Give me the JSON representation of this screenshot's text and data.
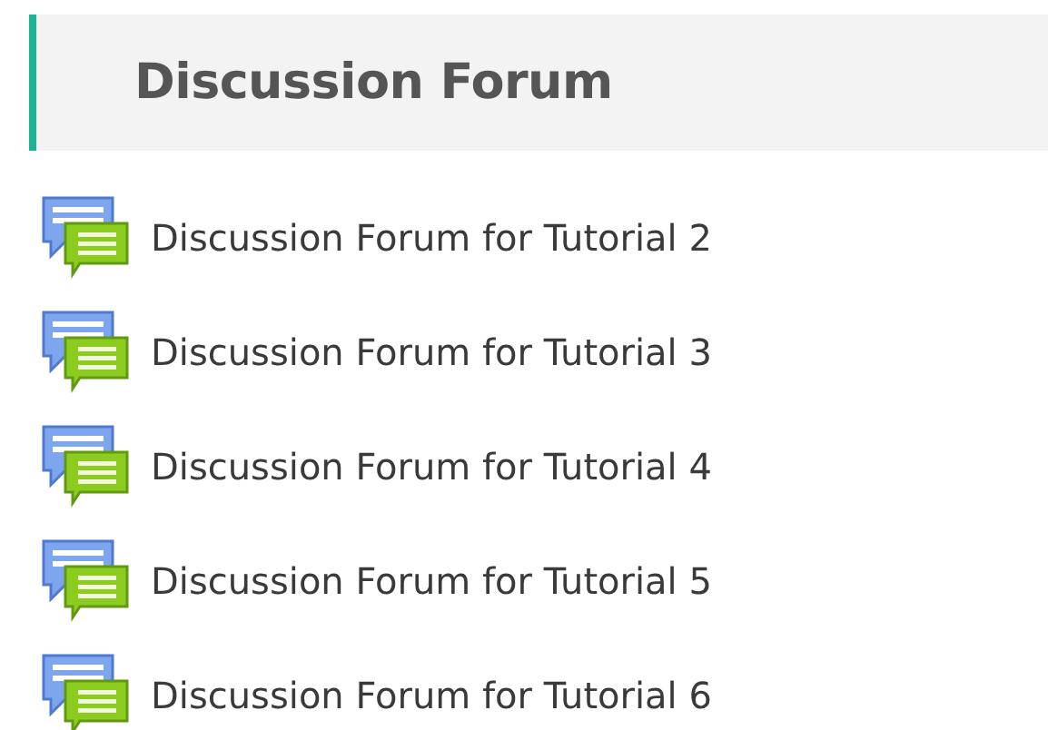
{
  "section": {
    "title": "Discussion Forum"
  },
  "forums": [
    {
      "label": "Discussion Forum for Tutorial 2"
    },
    {
      "label": "Discussion Forum for Tutorial 3"
    },
    {
      "label": "Discussion Forum for Tutorial 4"
    },
    {
      "label": "Discussion Forum for Tutorial 5"
    },
    {
      "label": "Discussion Forum for Tutorial 6"
    }
  ]
}
